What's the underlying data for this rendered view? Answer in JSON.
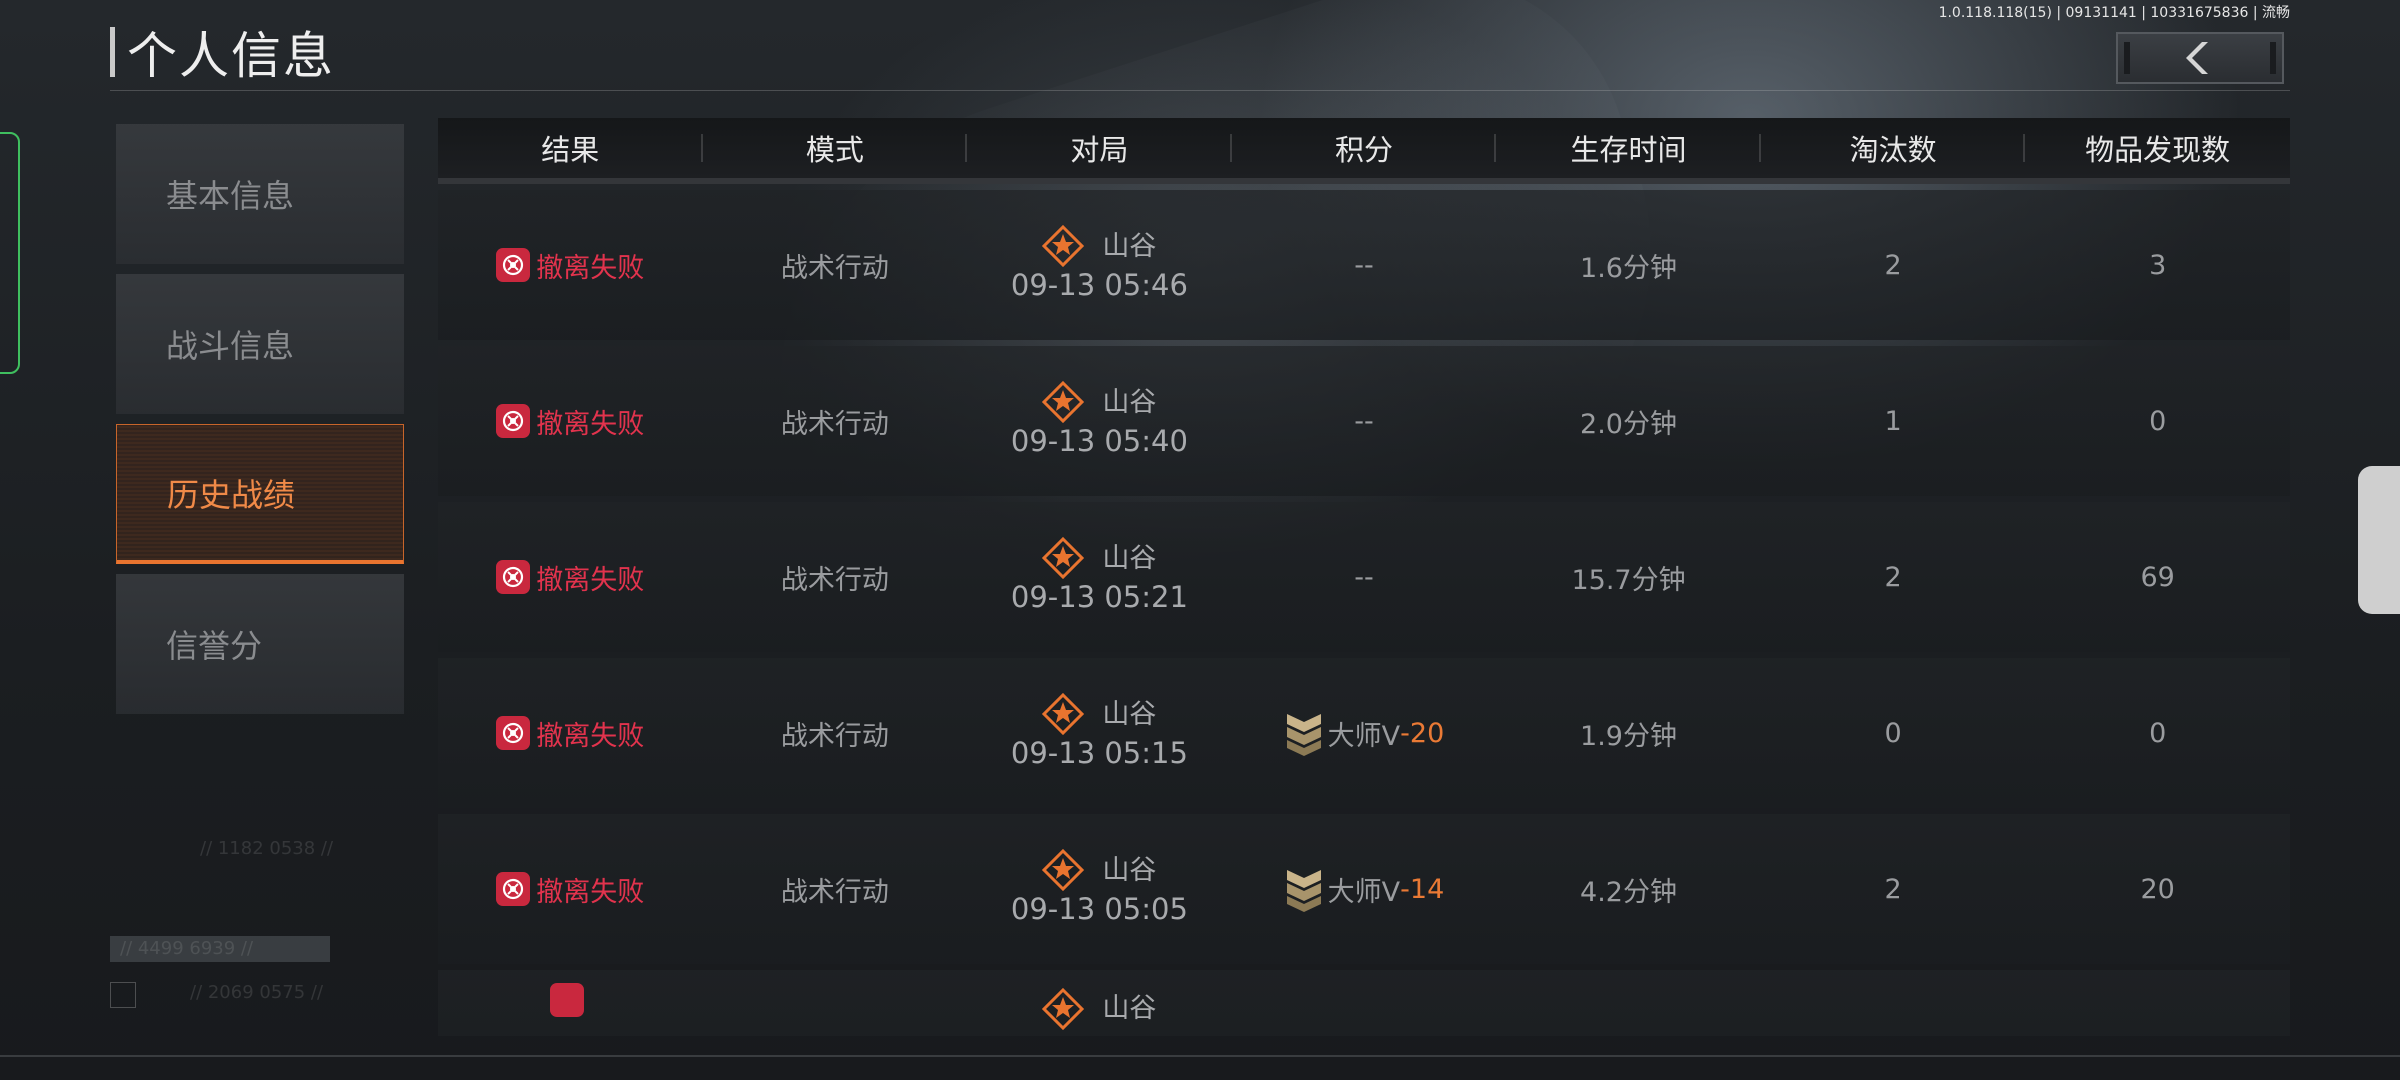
{
  "app": {
    "version_text": "1.0.118.118(15) | 09131141 | 10331675836 | 流畅",
    "title": "个人信息"
  },
  "sidebar": {
    "items": [
      {
        "label": "基本信息",
        "active": false
      },
      {
        "label": "战斗信息",
        "active": false
      },
      {
        "label": "历史战绩",
        "active": true
      },
      {
        "label": "信誉分",
        "active": false
      }
    ]
  },
  "background_text": {
    "coord_a": "// 1182 0538 //",
    "coord_b": "// 4499 6939 //",
    "coord_c": "// 2069 0575 //"
  },
  "table": {
    "headers": [
      "结果",
      "模式",
      "对局",
      "积分",
      "生存时间",
      "淘汰数",
      "物品发现数"
    ],
    "rows": [
      {
        "result": "撤离失败",
        "mode": "战术行动",
        "map": "山谷",
        "time": "09-13 05:46",
        "score_rank": "",
        "score_delta": "",
        "score_empty": "--",
        "survival": "1.6分钟",
        "kills": "2",
        "items": "3"
      },
      {
        "result": "撤离失败",
        "mode": "战术行动",
        "map": "山谷",
        "time": "09-13 05:40",
        "score_rank": "",
        "score_delta": "",
        "score_empty": "--",
        "survival": "2.0分钟",
        "kills": "1",
        "items": "0"
      },
      {
        "result": "撤离失败",
        "mode": "战术行动",
        "map": "山谷",
        "time": "09-13 05:21",
        "score_rank": "",
        "score_delta": "",
        "score_empty": "--",
        "survival": "15.7分钟",
        "kills": "2",
        "items": "69"
      },
      {
        "result": "撤离失败",
        "mode": "战术行动",
        "map": "山谷",
        "time": "09-13 05:15",
        "score_rank": "大师V",
        "score_delta": "-20",
        "score_empty": "",
        "survival": "1.9分钟",
        "kills": "0",
        "items": "0"
      },
      {
        "result": "撤离失败",
        "mode": "战术行动",
        "map": "山谷",
        "time": "09-13 05:05",
        "score_rank": "大师V",
        "score_delta": "-14",
        "score_empty": "",
        "survival": "4.2分钟",
        "kills": "2",
        "items": "20"
      },
      {
        "result": "",
        "mode": "",
        "map": "山谷",
        "time": "",
        "score_rank": "",
        "score_delta": "",
        "score_empty": "",
        "survival": "",
        "kills": "",
        "items": ""
      }
    ]
  },
  "icons": {
    "back": "chevron-left-icon",
    "fail": "fail-icon",
    "map": "valley-map-icon",
    "rank": "master-rank-icon"
  },
  "colors": {
    "accent": "#e9742f",
    "fail_red": "#e2334d",
    "score_delta": "#ea7a35"
  }
}
